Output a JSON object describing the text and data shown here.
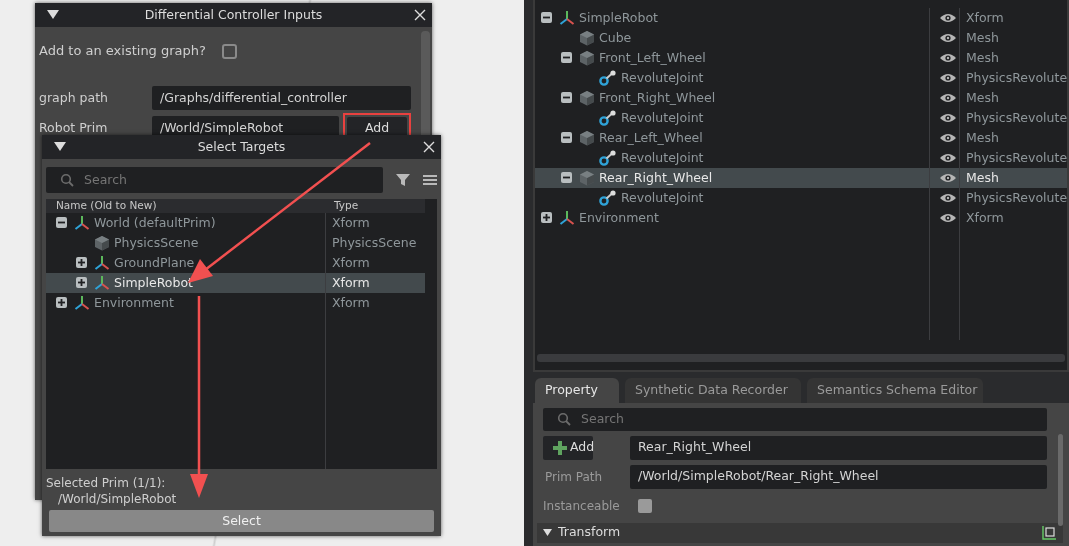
{
  "dialog": {
    "title": "Differential Controller Inputs",
    "option": {
      "label": "Add to an existing graph?",
      "checked": false
    },
    "fields": [
      {
        "label": "graph path",
        "value": "/Graphs/differential_controller"
      },
      {
        "label": "Robot Prim",
        "value": "/World/SimpleRobot",
        "button": "Add"
      }
    ]
  },
  "select_targets": {
    "title": "Select Targets",
    "search": {
      "placeholder": "Search"
    },
    "columns": [
      "Name (Old to New)",
      "Type"
    ],
    "tree": [
      {
        "name": "World (defaultPrim)",
        "type": "Xform",
        "kind": "xform",
        "expanded": true,
        "selected": false,
        "children": [
          {
            "name": "PhysicsScene",
            "type": "PhysicsScene",
            "kind": "mesh",
            "selected": false
          },
          {
            "name": "GroundPlane",
            "type": "Xform",
            "kind": "xform",
            "expanded": false,
            "selected": false
          },
          {
            "name": "SimpleRobot",
            "type": "Xform",
            "kind": "xform",
            "expanded": false,
            "selected": true
          }
        ]
      },
      {
        "name": "Environment",
        "type": "Xform",
        "kind": "xform",
        "expanded": false,
        "selected": false
      }
    ],
    "selected_label": "Selected Prim (1/1):",
    "selected_path": "/World/SimpleRobot",
    "button": "Select"
  },
  "stage": {
    "tree": [
      {
        "name": "SimpleRobot",
        "type": "Xform",
        "kind": "xform",
        "expanded": true,
        "selected": false,
        "children": [
          {
            "name": "Cube",
            "type": "Mesh",
            "kind": "mesh",
            "selected": false
          },
          {
            "name": "Front_Left_Wheel",
            "type": "Mesh",
            "kind": "mesh",
            "expanded": true,
            "selected": false,
            "children": [
              {
                "name": "RevoluteJoint",
                "type": "PhysicsRevolute",
                "kind": "joint",
                "selected": false
              }
            ]
          },
          {
            "name": "Front_Right_Wheel",
            "type": "Mesh",
            "kind": "mesh",
            "expanded": true,
            "selected": false,
            "children": [
              {
                "name": "RevoluteJoint",
                "type": "PhysicsRevolute",
                "kind": "joint",
                "selected": false
              }
            ]
          },
          {
            "name": "Rear_Left_Wheel",
            "type": "Mesh",
            "kind": "mesh",
            "expanded": true,
            "selected": false,
            "children": [
              {
                "name": "RevoluteJoint",
                "type": "PhysicsRevolute",
                "kind": "joint",
                "selected": false
              }
            ]
          },
          {
            "name": "Rear_Right_Wheel",
            "type": "Mesh",
            "kind": "mesh",
            "expanded": true,
            "selected": true,
            "children": [
              {
                "name": "RevoluteJoint",
                "type": "PhysicsRevolute",
                "kind": "joint",
                "selected": false
              }
            ]
          }
        ]
      },
      {
        "name": "Environment",
        "type": "Xform",
        "kind": "xform",
        "expanded": false,
        "selected": false
      }
    ]
  },
  "property": {
    "tabs": [
      {
        "label": "Property",
        "selected": true
      },
      {
        "label": "Synthetic Data Recorder",
        "selected": false
      },
      {
        "label": "Semantics Schema Editor",
        "selected": false
      }
    ],
    "search": {
      "placeholder": "Search"
    },
    "add_button": "Add",
    "name_value": "Rear_Right_Wheel",
    "fields": [
      {
        "label": "Prim Path",
        "value": "/World/SimpleRobot/Rear_Right_Wheel"
      }
    ],
    "option": {
      "label": "Instanceable",
      "checked": false
    },
    "section": {
      "title": "Transform",
      "expanded": true
    }
  }
}
